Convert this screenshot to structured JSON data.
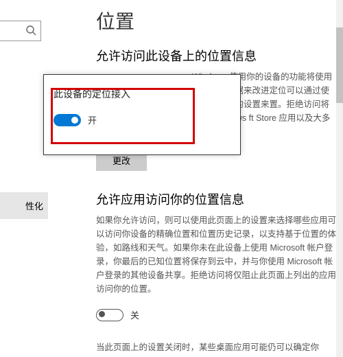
{
  "sidebar": {
    "search_placeholder": "",
    "nav_item": "性化"
  },
  "page": {
    "title": "位置",
    "section1_heading": "允许访问此设备上的位置信息",
    "section1_para_right": "Windows 使用你的设备的功能将使用你的位置数据来改进定位可以通过使用此页面上的设置来置。拒绝访问将阻止 Windows ft Store 应用以及大多数桌面应",
    "change_btn": "更改",
    "section2_heading": "允许应用访问你的位置信息",
    "section2_para": "如果你允许访问，则可以使用此页面上的设置来选择哪些应用可以访问你设备的精确位置和位置历史记录，以支持基于位置的体验，如路线和天气。如果你未在此设备上使用 Microsoft 帐户登录，你最后的已知位置将保存到云中，并与你使用 Microsoft 帐户登录的其他设备共享。拒绝访问将仅阻止此页面上列出的应用访问你的位置。",
    "toggle2_label": "关",
    "footer_line": "当此页面上的设置关闭时，某些桌面应用可能仍可以确定你"
  },
  "popup": {
    "heading": "此设备的定位接入",
    "toggle_label": "开"
  }
}
